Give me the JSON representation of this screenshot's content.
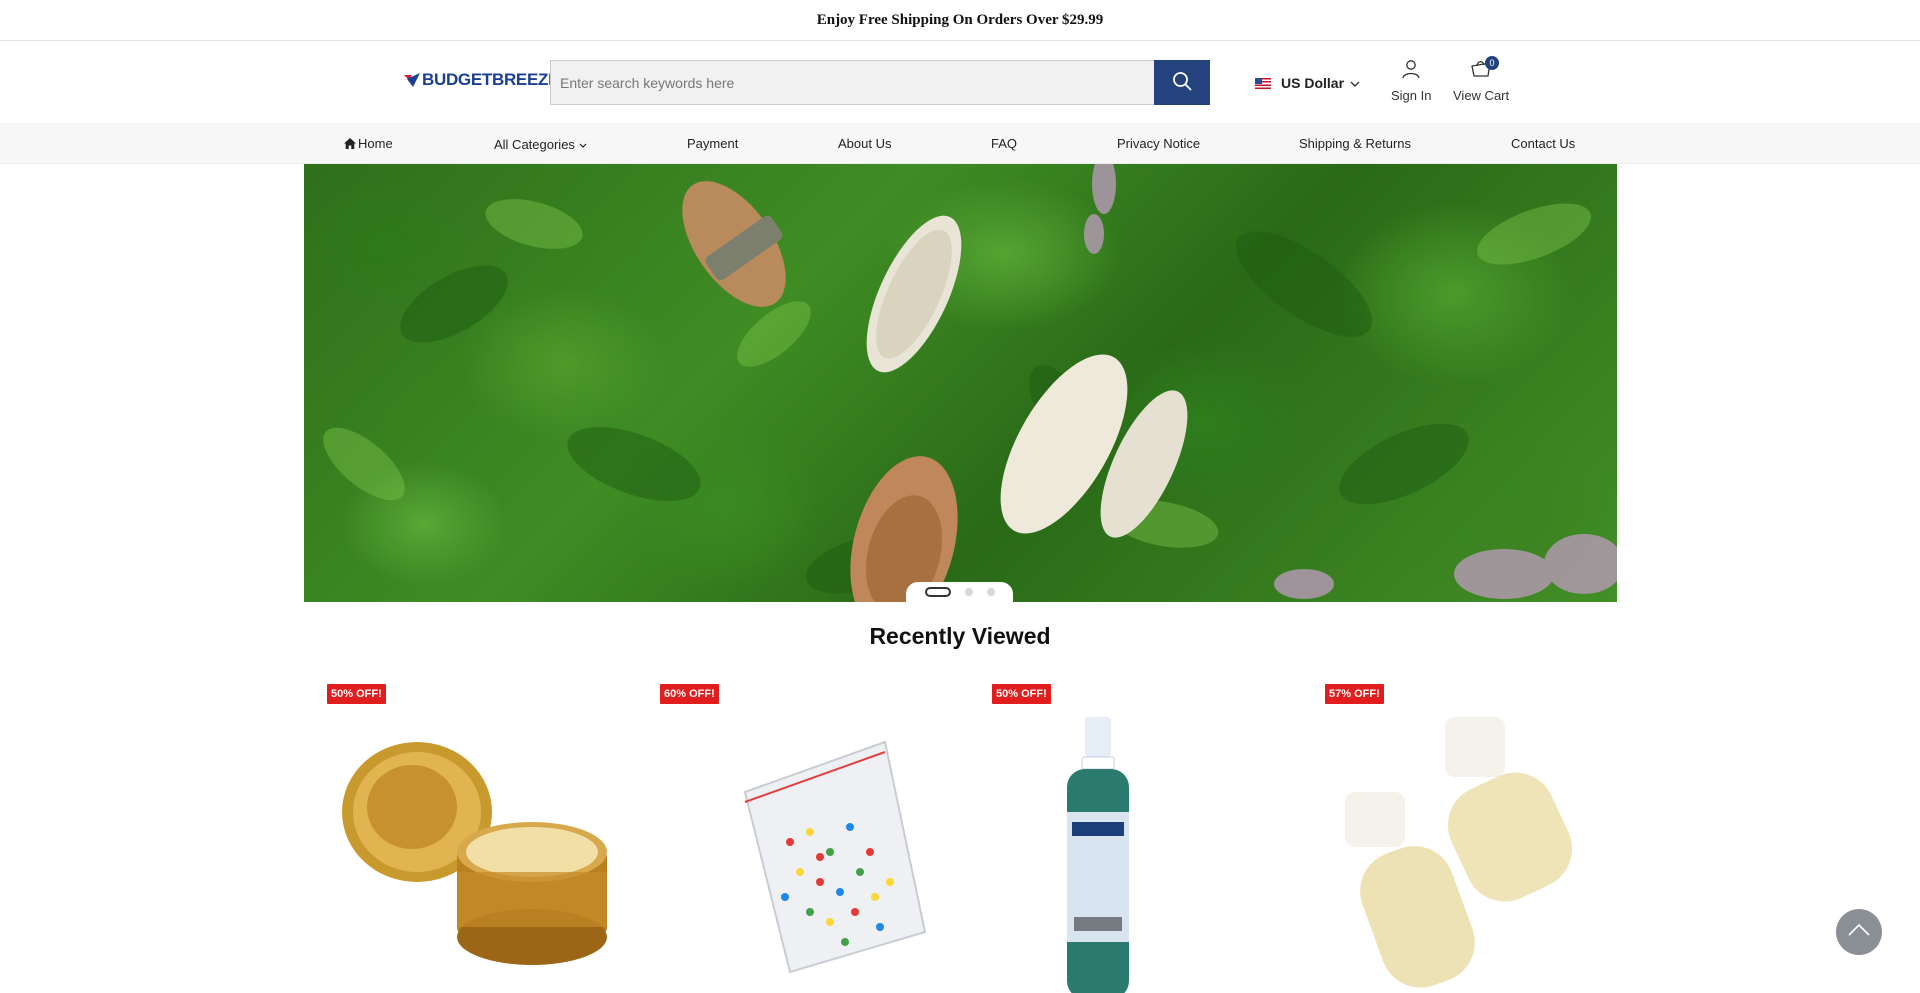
{
  "announcement": "Enjoy Free Shipping On Orders Over $29.99",
  "logo": {
    "text": "BUDGETBREEZE"
  },
  "search": {
    "placeholder": "Enter search keywords here",
    "value": ""
  },
  "currency": {
    "label": "US Dollar"
  },
  "account": {
    "sign_in": "Sign In",
    "view_cart": "View Cart",
    "cart_count": "0"
  },
  "nav": {
    "items": [
      {
        "label": "Home",
        "icon": "home-icon"
      },
      {
        "label": "All Categories",
        "icon": "chevron-down-icon"
      },
      {
        "label": "Payment"
      },
      {
        "label": "About Us"
      },
      {
        "label": "FAQ"
      },
      {
        "label": "Privacy Notice"
      },
      {
        "label": "Shipping & Returns"
      },
      {
        "label": "Contact Us"
      }
    ]
  },
  "banner": {
    "slide_count": 3,
    "active_slide": 1
  },
  "recently_viewed": {
    "title": "Recently Viewed",
    "products": [
      {
        "discount": "50% OFF!",
        "image": "frankincense-myrrh-candle-tins"
      },
      {
        "discount": "60% OFF!",
        "image": "bag-of-colored-leds"
      },
      {
        "discount": "50% OFF!",
        "image": "steri-spray-bottle"
      },
      {
        "discount": "57% OFF!",
        "image": "plastic-bottle-stoppers"
      }
    ]
  },
  "colors": {
    "brand_blue": "#23427e",
    "sale_red": "#e01e1e",
    "logo_red": "#d0202e"
  }
}
